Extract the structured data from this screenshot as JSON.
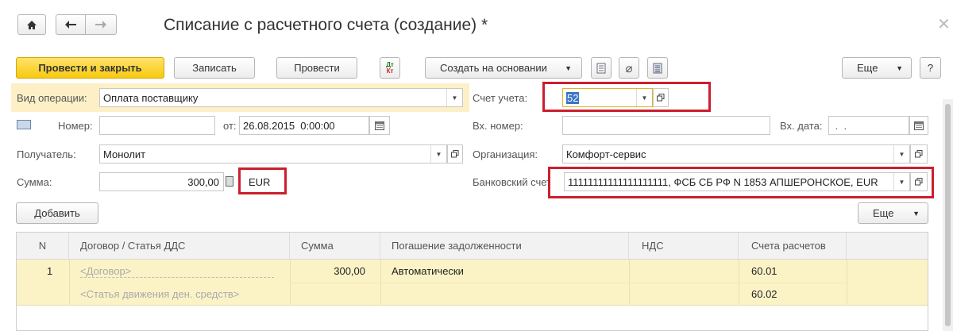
{
  "window": {
    "title": "Списание с расчетного счета (создание) *"
  },
  "nav": {
    "home_icon": "home-icon",
    "back_icon": "arrow-left-icon",
    "forward_icon": "arrow-right-icon"
  },
  "toolbar": {
    "post_close_label": "Провести и закрыть",
    "save_label": "Записать",
    "post_label": "Провести",
    "dtkt_label": "Дт Кт",
    "create_based_label": "Создать на основании",
    "more_label": "Еще",
    "help_label": "?"
  },
  "form": {
    "operation_label": "Вид операции:",
    "operation_value": "Оплата поставщику",
    "number_label": "Номер:",
    "number_value": "",
    "from_label": "от:",
    "date_value": "26.08.2015  0:00:00",
    "recipient_label": "Получатель:",
    "recipient_value": "Монолит",
    "amount_label": "Сумма:",
    "amount_value": "300,00",
    "currency_value": "EUR",
    "account_label": "Счет учета:",
    "account_value": "52",
    "in_number_label": "Вх. номер:",
    "in_number_value": "",
    "in_date_label": "Вх. дата:",
    "in_date_value": " .  .",
    "org_label": "Организация:",
    "org_value": "Комфорт-сервис",
    "bank_label": "Банковский счет:",
    "bank_value": "11111111111111111111, ФСБ СБ РФ N 1853 АПШЕРОНСКОЕ, EUR"
  },
  "table_toolbar": {
    "add_label": "Добавить",
    "more_label": "Еще"
  },
  "table": {
    "headers": [
      "N",
      "Договор / Статья ДДС",
      "Сумма",
      "Погашение задолженности",
      "НДС",
      "Счета расчетов"
    ],
    "row": {
      "n": "1",
      "contract_placeholder": "<Договор>",
      "dds_placeholder": "<Статья движения ден. средств>",
      "sum": "300,00",
      "repayment": "Автоматически",
      "vat": "",
      "account1": "60.01",
      "account2": "60.02"
    }
  },
  "colors": {
    "highlight_red": "#cc1f2e",
    "primary_yellow": "#f7c910",
    "row_yellow": "#fbf3c6"
  }
}
